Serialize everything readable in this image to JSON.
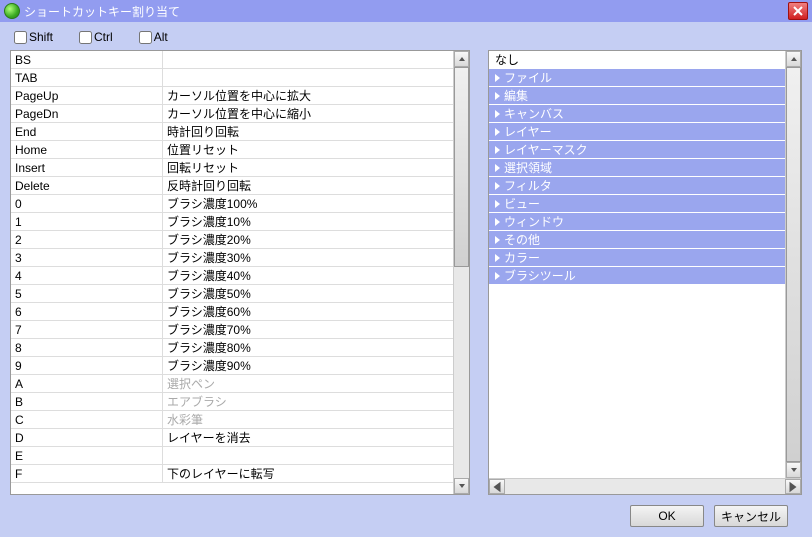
{
  "window": {
    "title": "ショートカットキー割り当て"
  },
  "modifiers": {
    "shift": "Shift",
    "ctrl": "Ctrl",
    "alt": "Alt"
  },
  "shortcuts": [
    {
      "key": "BS",
      "action": ""
    },
    {
      "key": "TAB",
      "action": ""
    },
    {
      "key": "PageUp",
      "action": "カーソル位置を中心に拡大"
    },
    {
      "key": "PageDn",
      "action": "カーソル位置を中心に縮小"
    },
    {
      "key": "End",
      "action": "時計回り回転"
    },
    {
      "key": "Home",
      "action": "位置リセット"
    },
    {
      "key": "Insert",
      "action": "回転リセット"
    },
    {
      "key": "Delete",
      "action": "反時計回り回転"
    },
    {
      "key": "0",
      "action": "ブラシ濃度100%"
    },
    {
      "key": "1",
      "action": "ブラシ濃度10%"
    },
    {
      "key": "2",
      "action": "ブラシ濃度20%"
    },
    {
      "key": "3",
      "action": "ブラシ濃度30%"
    },
    {
      "key": "4",
      "action": "ブラシ濃度40%"
    },
    {
      "key": "5",
      "action": "ブラシ濃度50%"
    },
    {
      "key": "6",
      "action": "ブラシ濃度60%"
    },
    {
      "key": "7",
      "action": "ブラシ濃度70%"
    },
    {
      "key": "8",
      "action": "ブラシ濃度80%"
    },
    {
      "key": "9",
      "action": "ブラシ濃度90%"
    },
    {
      "key": "A",
      "action": "選択ペン",
      "muted": true
    },
    {
      "key": "B",
      "action": "エアブラシ",
      "muted": true
    },
    {
      "key": "C",
      "action": "水彩筆",
      "muted": true
    },
    {
      "key": "D",
      "action": "レイヤーを消去"
    },
    {
      "key": "E",
      "action": ""
    },
    {
      "key": "F",
      "action": "下のレイヤーに転写"
    }
  ],
  "categories": [
    {
      "label": "なし",
      "selected": false
    },
    {
      "label": "ファイル",
      "selected": true
    },
    {
      "label": "編集",
      "selected": true
    },
    {
      "label": "キャンバス",
      "selected": true
    },
    {
      "label": "レイヤー",
      "selected": true
    },
    {
      "label": "レイヤーマスク",
      "selected": true
    },
    {
      "label": "選択領域",
      "selected": true
    },
    {
      "label": "フィルタ",
      "selected": true
    },
    {
      "label": "ビュー",
      "selected": true
    },
    {
      "label": "ウィンドウ",
      "selected": true
    },
    {
      "label": "その他",
      "selected": true
    },
    {
      "label": "カラー",
      "selected": true
    },
    {
      "label": "ブラシツール",
      "selected": true
    }
  ],
  "buttons": {
    "ok": "OK",
    "cancel": "キャンセル"
  }
}
